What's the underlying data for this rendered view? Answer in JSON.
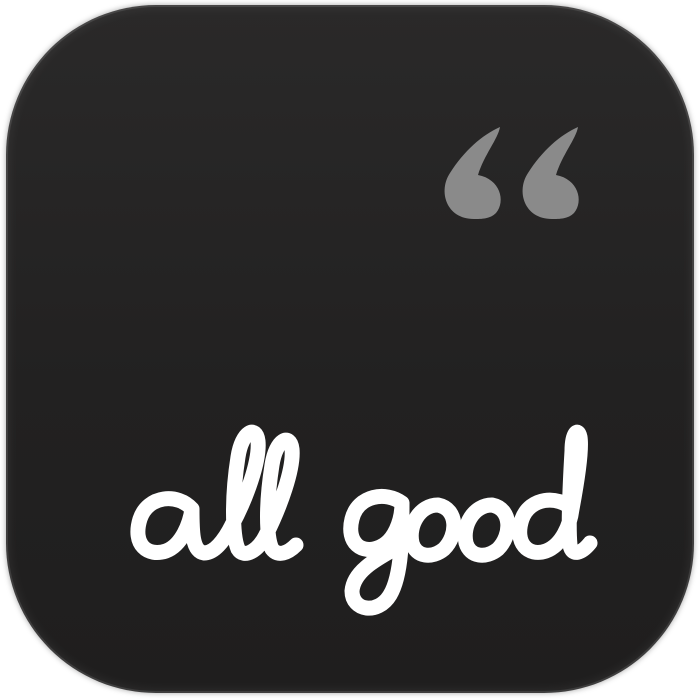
{
  "icon": {
    "wordmark": "all good",
    "quote_glyph": "“",
    "colors": {
      "background": "#242323",
      "wordmark": "#ffffff",
      "quote": "#8a8a8a"
    },
    "icons": [
      "quote-mark-icon"
    ]
  }
}
